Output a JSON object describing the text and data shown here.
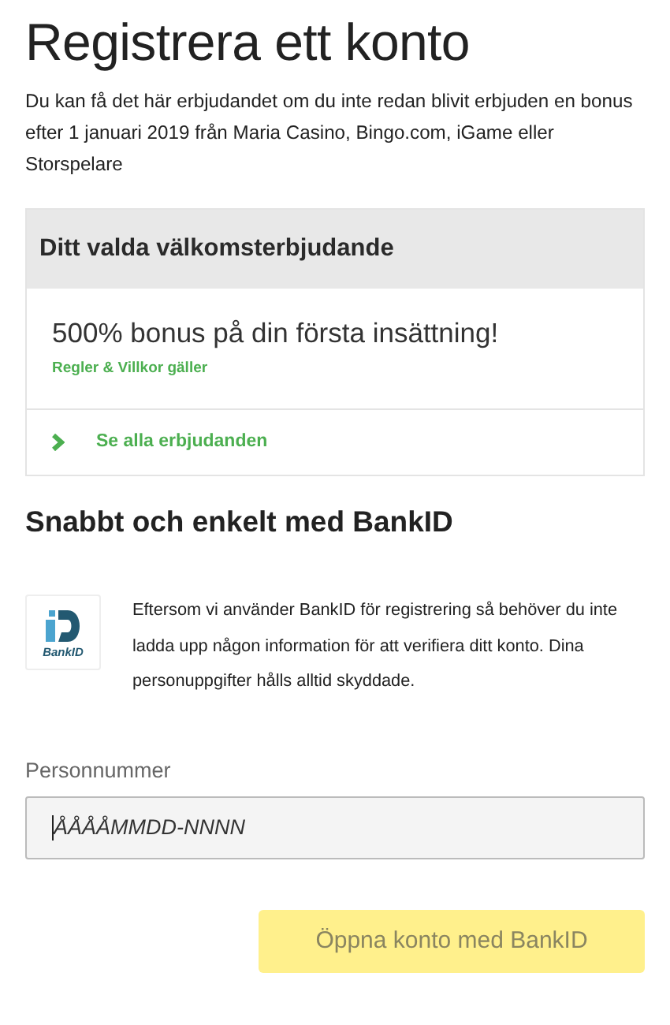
{
  "title": "Registrera ett konto",
  "intro": "Du kan få det här erbjudandet om du inte redan blivit erbjuden en bonus efter 1 januari 2019 från Maria Casino, Bingo.com, iGame eller Storspelare",
  "offer_card": {
    "header": "Ditt valda välkomsterbjudande",
    "offer": "500% bonus på din första insättning!",
    "terms_link": "Regler & Villkor gäller",
    "all_offers_link": "Se alla erbjudanden"
  },
  "bankid_section": {
    "heading": "Snabbt och enkelt med BankID",
    "logo_label": "BankID",
    "text": "Eftersom vi använder BankID för registrering så behöver du inte ladda upp någon information för att verifiera ditt konto. Dina personuppgifter hålls alltid skyddade."
  },
  "personnummer_field": {
    "label": "Personnummer",
    "placeholder": "ÅÅÅÅMMDD-NNNN"
  },
  "submit_button": {
    "label": "Öppna konto med BankID",
    "disabled": true
  }
}
